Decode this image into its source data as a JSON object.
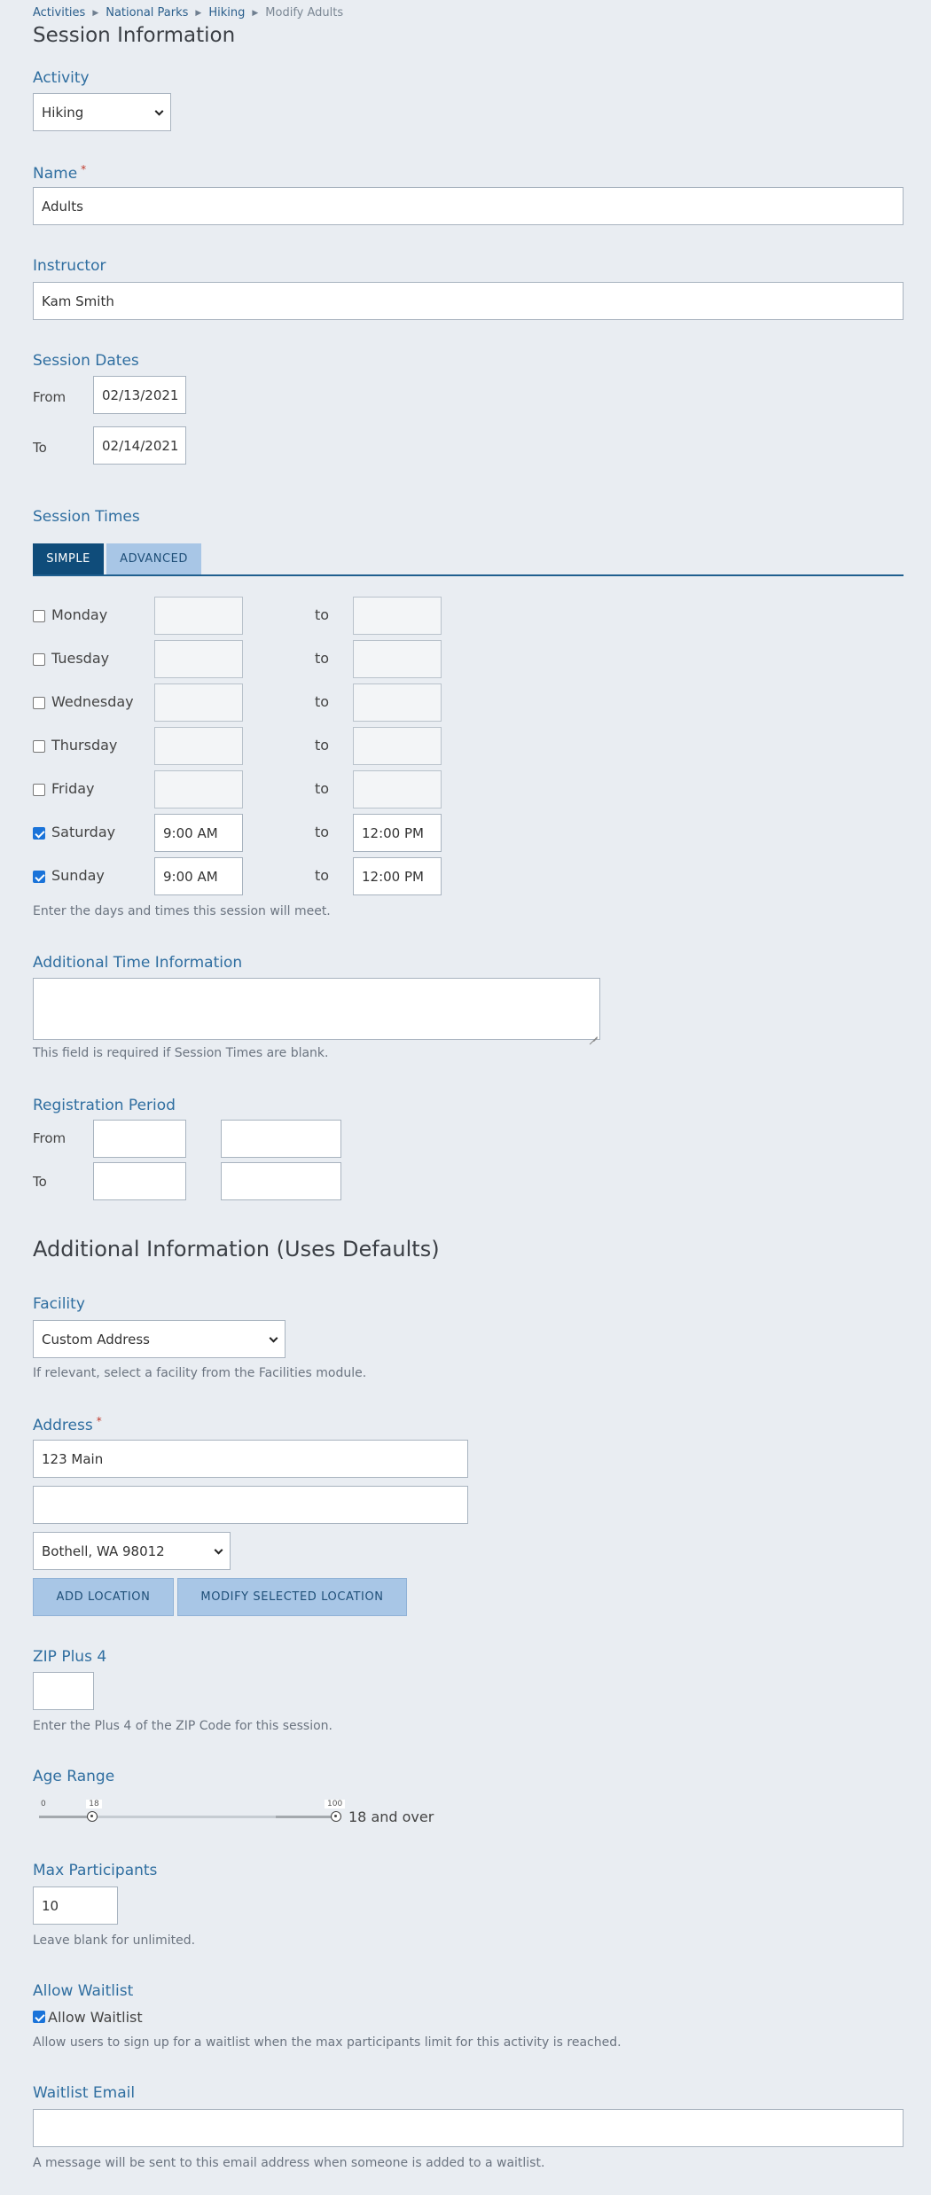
{
  "breadcrumbs": [
    "Activities",
    "National Parks",
    "Hiking",
    "Modify Adults"
  ],
  "session_info": {
    "title": "Session Information",
    "activity_label": "Activity",
    "activity_value": "Hiking",
    "name_label": "Name",
    "required_mark": "*",
    "name_value": "Adults",
    "instructor_label": "Instructor",
    "instructor_value": "Kam Smith",
    "dates_label": "Session Dates",
    "from_label": "From",
    "to_label": "To",
    "from_date": "02/13/2021",
    "to_date": "02/14/2021"
  },
  "session_times": {
    "label": "Session Times",
    "tabs": [
      {
        "label": "SIMPLE",
        "active": true
      },
      {
        "label": "ADVANCED",
        "active": false
      }
    ],
    "to_word": "to",
    "days": [
      {
        "name": "Monday",
        "checked": false,
        "start": "",
        "end": ""
      },
      {
        "name": "Tuesday",
        "checked": false,
        "start": "",
        "end": ""
      },
      {
        "name": "Wednesday",
        "checked": false,
        "start": "",
        "end": ""
      },
      {
        "name": "Thursday",
        "checked": false,
        "start": "",
        "end": ""
      },
      {
        "name": "Friday",
        "checked": false,
        "start": "",
        "end": ""
      },
      {
        "name": "Saturday",
        "checked": true,
        "start": "9:00 AM",
        "end": "12:00 PM"
      },
      {
        "name": "Sunday",
        "checked": true,
        "start": "9:00 AM",
        "end": "12:00 PM"
      }
    ],
    "help": "Enter the days and times this session will meet."
  },
  "additional_time": {
    "label": "Additional Time Information",
    "value": "",
    "help": "This field is required if Session Times are blank."
  },
  "registration": {
    "label": "Registration Period",
    "from_label": "From",
    "to_label": "To",
    "from_date": "",
    "from_time": "",
    "to_date": "",
    "to_time": ""
  },
  "additional_info": {
    "title": "Additional Information (Uses Defaults)",
    "facility_label": "Facility",
    "facility_value": "Custom Address",
    "facility_help": "If relevant, select a facility from the Facilities module.",
    "address_label": "Address",
    "address_line1": "123 Main",
    "address_line2": "",
    "location_value": "Bothell, WA 98012",
    "add_location_label": "ADD LOCATION",
    "modify_location_label": "MODIFY SELECTED LOCATION",
    "zip4_label": "ZIP Plus 4",
    "zip4_value": "",
    "zip4_help": "Enter the Plus 4 of the ZIP Code for this session."
  },
  "age_range": {
    "label": "Age Range",
    "min": 0,
    "max": 100,
    "low": 18,
    "high": 100,
    "min_text": "0",
    "low_text": "18",
    "high_text": "100",
    "summary": "18 and over"
  },
  "participants": {
    "label": "Max Participants",
    "value": "10",
    "help": "Leave blank for unlimited."
  },
  "waitlist": {
    "label": "Allow Waitlist",
    "checkbox_label": "Allow Waitlist",
    "checked": true,
    "help": "Allow users to sign up for a waitlist when the max participants limit for this activity is reached.",
    "email_label": "Waitlist Email",
    "email_value": "",
    "email_help": "A message will be sent to this email address when someone is added to a waitlist."
  },
  "icons": {
    "checkbox_checked": "checkbox-checked-icon",
    "chevron": "chevron-down-icon",
    "breadcrumb_separator": "triangle-right-icon"
  },
  "colors": {
    "label_blue": "#2f6ea0",
    "tab_active": "#0f4c7a",
    "tab_inactive": "#a8c6e6",
    "checkbox_checked": "#1a73d9",
    "required": "#c0392b"
  }
}
